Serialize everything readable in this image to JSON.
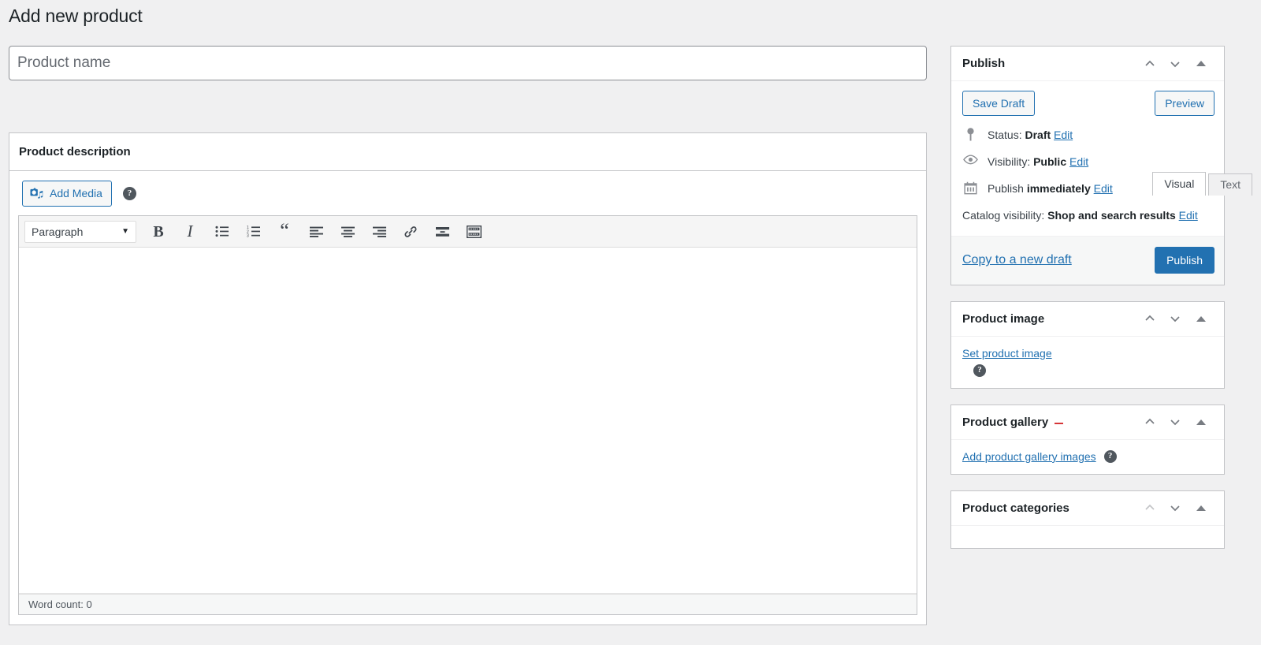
{
  "page": {
    "title": "Add new product"
  },
  "title_field": {
    "placeholder": "Product name",
    "value": ""
  },
  "editor": {
    "box_title": "Product description",
    "add_media_label": "Add Media",
    "help_glyph": "?",
    "tabs": [
      {
        "label": "Visual",
        "active": true
      },
      {
        "label": "Text",
        "active": false
      }
    ],
    "format_select": {
      "value": "Paragraph",
      "caret": "▼"
    },
    "toolbar": [
      {
        "name": "bold-icon",
        "label": "B"
      },
      {
        "name": "italic-icon",
        "label": "I"
      },
      {
        "name": "bulleted-list-icon",
        "label": ""
      },
      {
        "name": "numbered-list-icon",
        "label": ""
      },
      {
        "name": "blockquote-icon",
        "label": "“"
      },
      {
        "name": "align-left-icon",
        "label": ""
      },
      {
        "name": "align-center-icon",
        "label": ""
      },
      {
        "name": "align-right-icon",
        "label": ""
      },
      {
        "name": "link-icon",
        "label": ""
      },
      {
        "name": "read-more-icon",
        "label": ""
      },
      {
        "name": "toolbar-toggle-icon",
        "label": ""
      }
    ],
    "word_count": "Word count: 0"
  },
  "publish_box": {
    "title": "Publish",
    "save_draft_label": "Save Draft",
    "preview_label": "Preview",
    "status_label": "Status:",
    "status_value": "Draft",
    "status_edit": "Edit",
    "visibility_label": "Visibility:",
    "visibility_value": "Public",
    "visibility_edit": "Edit",
    "publish_label": "Publish",
    "publish_value": "immediately",
    "publish_edit": "Edit",
    "catalog_label": "Catalog visibility:",
    "catalog_value": "Shop and search results",
    "catalog_edit": "Edit",
    "copy_draft_label": "Copy to a new draft",
    "publish_button_label": "Publish"
  },
  "product_image_box": {
    "title": "Product image",
    "set_image_link": "Set product image",
    "help_glyph": "?"
  },
  "product_gallery_box": {
    "title": "Product gallery",
    "add_gallery_link": "Add product gallery images",
    "help_glyph": "?"
  },
  "product_categories_box": {
    "title": "Product categories"
  },
  "colors": {
    "accent": "#2271b1",
    "page_bg": "#f0f0f1",
    "box_border": "#c3c4c7",
    "text": "#3c434a",
    "heading": "#1d2327",
    "red_marker": "#d63638"
  }
}
